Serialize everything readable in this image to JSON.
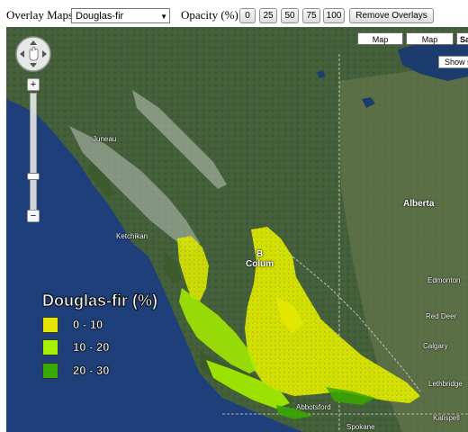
{
  "toolbar": {
    "overlay_label": "Overlay Maps:",
    "overlay_selected": "Douglas-fir",
    "opacity_label": "Opacity (%):",
    "opacity_buttons": [
      "0",
      "25",
      "50",
      "75",
      "100"
    ],
    "remove_label": "Remove Overlays"
  },
  "map_controls": {
    "map_type_buttons": [
      "Map",
      "Map",
      "Sa"
    ],
    "show_checkbox_label": "Show s",
    "zoom_in": "+",
    "zoom_out": "−"
  },
  "places": {
    "juneau": "Juneau",
    "ketchikan": "Ketchikan",
    "british_columbia_1": "B",
    "british_columbia_2": "Colum",
    "alberta": "Alberta",
    "edmonton": "Edmonton",
    "red_deer": "Red Deer",
    "calgary": "Calgary",
    "lethbridge": "Lethbridge",
    "abbotsford": "Abbotsford",
    "spokane": "Spokane",
    "kalispell": "Kalispell"
  },
  "legend": {
    "title": "Douglas-fir (%)",
    "items": [
      {
        "label": "0 - 10",
        "color": "#e2e600"
      },
      {
        "label": "10 - 20",
        "color": "#a6f000"
      },
      {
        "label": "20 - 30",
        "color": "#3aa800"
      }
    ]
  },
  "colors": {
    "ocean": "#1e3f7a",
    "land_forest": "#3c5a2c",
    "mountain": "#7f8e78",
    "fir_low": "#e2e600",
    "fir_mid": "#a6f000",
    "fir_high": "#3aa800"
  }
}
